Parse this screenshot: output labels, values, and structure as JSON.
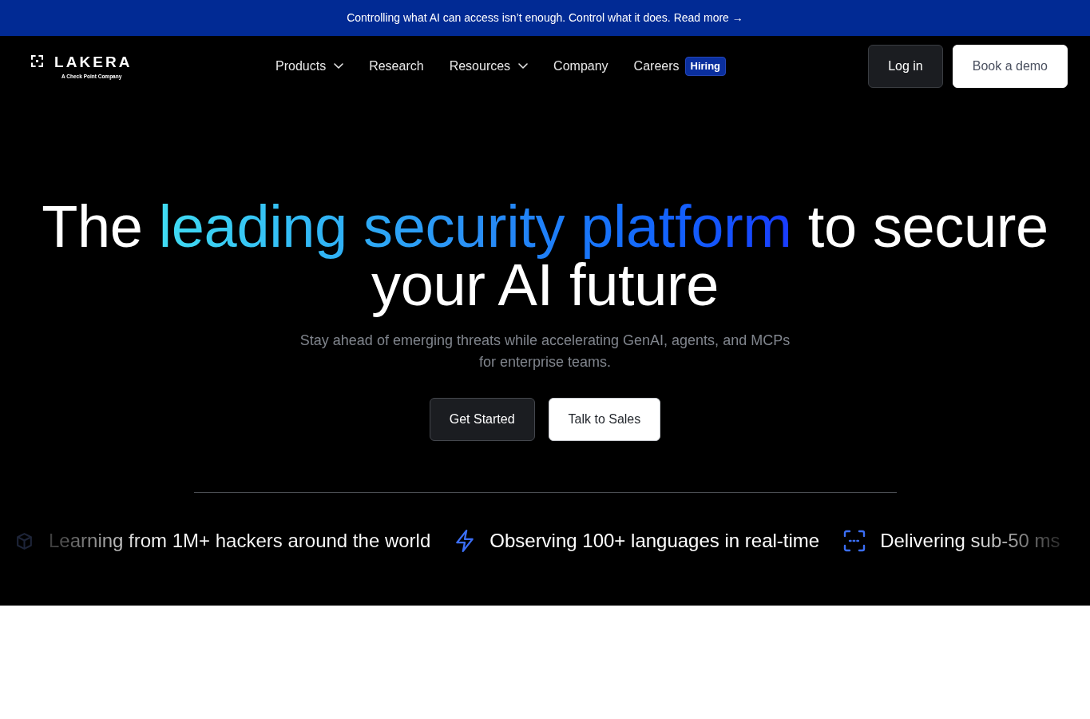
{
  "announcement": {
    "text": "Controlling what AI can access isn’t enough. Control what it does.",
    "link": "Read more →"
  },
  "header": {
    "logo": {
      "wordmark": "LAKERA",
      "tagline": "A Check Point Company"
    },
    "nav": [
      {
        "label": "Products",
        "kind": "dropdown"
      },
      {
        "label": "Research",
        "kind": "link"
      },
      {
        "label": "Resources",
        "kind": "dropdown"
      },
      {
        "label": "Company",
        "kind": "link"
      },
      {
        "label": "Careers",
        "kind": "link",
        "badge": "Hiring"
      }
    ],
    "actions": [
      {
        "label": "Log in",
        "kind": "dark"
      },
      {
        "label": "Book a demo",
        "kind": "light"
      }
    ]
  },
  "hero": {
    "headline": {
      "before": "The",
      "highlight": "leading security platform",
      "after": "to secure your AI future"
    },
    "subtitle": "Stay ahead of emerging threats while accelerating GenAI, agents, and MCPs for enterprise teams.",
    "buttons": [
      {
        "label": "Get Started",
        "kind": "dark"
      },
      {
        "label": "Talk to Sales",
        "kind": "light"
      }
    ]
  },
  "features": [
    {
      "text": "Learning from 1M+ hackers around the world"
    },
    {
      "text": "Observing 100+ languages in real-time"
    },
    {
      "text": "Delivering sub-50 ms"
    }
  ]
}
